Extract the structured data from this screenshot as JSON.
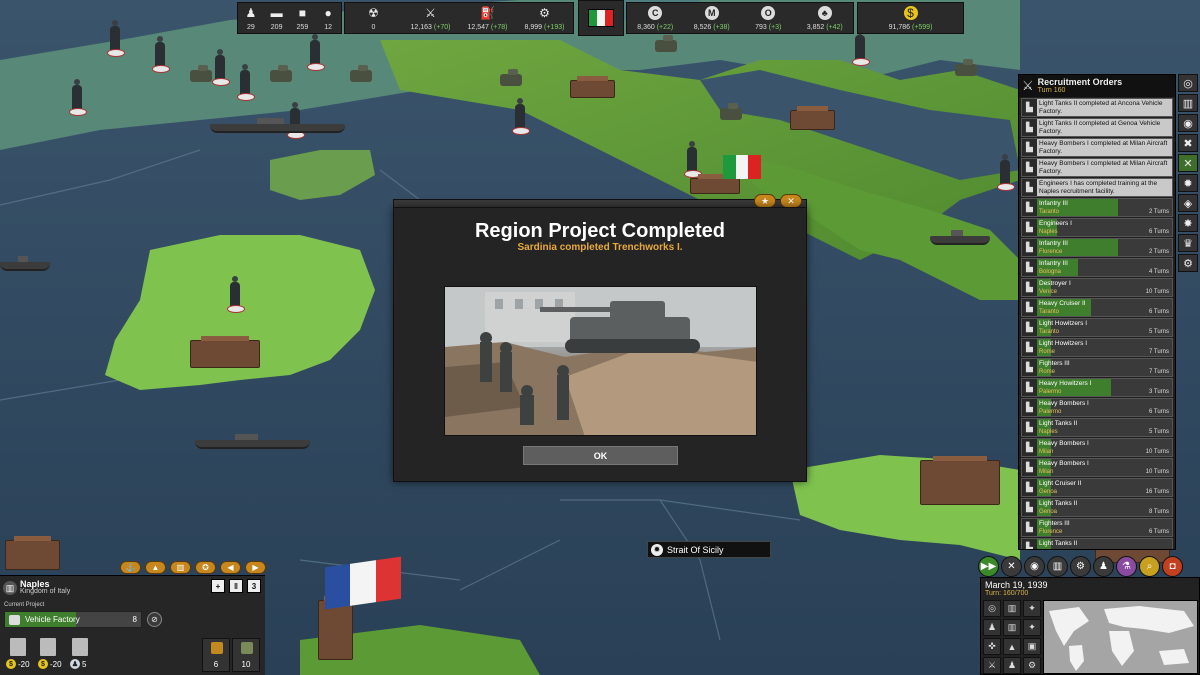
{
  "resources_left": [
    {
      "icon": "infantry-icon",
      "glyph": "♟",
      "value": "29"
    },
    {
      "icon": "truck-icon",
      "glyph": "▬",
      "value": "209"
    },
    {
      "icon": "tank-icon",
      "glyph": "■",
      "value": "259"
    },
    {
      "icon": "bomb-icon",
      "glyph": "●",
      "value": "12"
    }
  ],
  "resources_mid": [
    {
      "icon": "nuclear-icon",
      "glyph": "☢",
      "value": "0",
      "change": ""
    },
    {
      "icon": "manpower-icon",
      "glyph": "⚔",
      "value": "12,163",
      "change": "(+70)"
    },
    {
      "icon": "oil-icon",
      "glyph": "⛽",
      "value": "12,547",
      "change": "(+78)"
    },
    {
      "icon": "industry-icon",
      "glyph": "⚙",
      "value": "8,999",
      "change": "(+193)"
    }
  ],
  "resources_right": [
    {
      "icon": "coal-icon",
      "glyph": "C",
      "value": "8,360",
      "change": "(+22)"
    },
    {
      "icon": "metal-icon",
      "glyph": "M",
      "value": "8,526",
      "change": "(+38)"
    },
    {
      "icon": "oil-drop-icon",
      "glyph": "O",
      "value": "793",
      "change": "(+3)"
    },
    {
      "icon": "food-icon",
      "glyph": "♣",
      "value": "3,852",
      "change": "(+42)"
    }
  ],
  "money": {
    "icon": "money-icon",
    "glyph": "$",
    "value": "91,786",
    "change": "(+599)"
  },
  "recruitment": {
    "title": "Recruitment Orders",
    "turn": "Turn 160",
    "completed": [
      "Light Tanks II completed at Ancona Vehicle Factory.",
      "Light Tanks II completed at Genoa Vehicle Factory.",
      "Heavy Bombers I completed at Milan Aircraft Factory.",
      "Heavy Bombers I completed at Milan Aircraft Factory.",
      "Engineers I has completed training at the Naples recruitment facility."
    ],
    "orders": [
      {
        "unit": "Infantry III",
        "location": "Taranto",
        "turns": "2 Turns",
        "progress": 0.6
      },
      {
        "unit": "Engineers I",
        "location": "Naples",
        "turns": "6 Turns",
        "progress": 0.15
      },
      {
        "unit": "Infantry III",
        "location": "Florence",
        "turns": "2 Turns",
        "progress": 0.6
      },
      {
        "unit": "Infantry III",
        "location": "Bologna",
        "turns": "4 Turns",
        "progress": 0.3
      },
      {
        "unit": "Destroyer I",
        "location": "Venice",
        "turns": "10 Turns",
        "progress": 0.1
      },
      {
        "unit": "Heavy Cruiser II",
        "location": "Taranto",
        "turns": "6 Turns",
        "progress": 0.4
      },
      {
        "unit": "Light Howitzers I",
        "location": "Taranto",
        "turns": "5 Turns",
        "progress": 0.1
      },
      {
        "unit": "Light Howitzers I",
        "location": "Rome",
        "turns": "7 Turns",
        "progress": 0.1
      },
      {
        "unit": "Fighters III",
        "location": "Rome",
        "turns": "7 Turns",
        "progress": 0.1
      },
      {
        "unit": "Heavy Howitzers I",
        "location": "Palermo",
        "turns": "3 Turns",
        "progress": 0.55
      },
      {
        "unit": "Heavy Bombers I",
        "location": "Palermo",
        "turns": "6 Turns",
        "progress": 0.1
      },
      {
        "unit": "Light Tanks II",
        "location": "Naples",
        "turns": "5 Turns",
        "progress": 0.1
      },
      {
        "unit": "Heavy Bombers I",
        "location": "Milan",
        "turns": "10 Turns",
        "progress": 0.1
      },
      {
        "unit": "Heavy Bombers I",
        "location": "Milan",
        "turns": "10 Turns",
        "progress": 0.1
      },
      {
        "unit": "Light Cruiser II",
        "location": "Genoa",
        "turns": "16 Turns",
        "progress": 0.1
      },
      {
        "unit": "Light Tanks II",
        "location": "Genoa",
        "turns": "8 Turns",
        "progress": 0.1
      },
      {
        "unit": "Fighters III",
        "location": "Florence",
        "turns": "6 Turns",
        "progress": 0.1
      },
      {
        "unit": "Light Tanks II",
        "location": "",
        "turns": "",
        "progress": 0.1
      }
    ]
  },
  "side_menu": [
    {
      "icon": "globe-icon",
      "glyph": "◎"
    },
    {
      "icon": "government-icon",
      "glyph": "▥"
    },
    {
      "icon": "diplomacy-icon",
      "glyph": "◉"
    },
    {
      "icon": "tools-icon",
      "glyph": "✖"
    },
    {
      "icon": "military-icon",
      "glyph": "✕"
    },
    {
      "icon": "fire-icon",
      "glyph": "✹"
    },
    {
      "icon": "shield-icon",
      "glyph": "◈"
    },
    {
      "icon": "burst-icon",
      "glyph": "✸"
    },
    {
      "icon": "research-icon",
      "glyph": "♛"
    },
    {
      "icon": "settings-icon",
      "glyph": "⚙"
    }
  ],
  "modal": {
    "title": "Region Project Completed",
    "subtitle": "Sardinia completed Trenchworks I.",
    "ok_label": "OK",
    "tab_star": "★",
    "tab_close": "✕"
  },
  "strait_label": "Strait Of Sicily",
  "region": {
    "name": "Naples",
    "kingdom": "Kingdom of Italy",
    "current_project_label": "Current Project",
    "project_name": "Vehicle Factory",
    "project_count": "8",
    "project_progress": 0.52,
    "cancel_glyph": "⊘",
    "money_1": "-20",
    "money_2": "-20",
    "pop": "5",
    "side_val_1": "6",
    "side_val_2": "10",
    "top_badge_1": "+",
    "top_badge_2": "‖",
    "top_badge_3": "3"
  },
  "bottom_actions": [
    "⚓",
    "▲",
    "▥",
    "✪",
    "◀",
    "▶"
  ],
  "date_panel": {
    "date": "March 19, 1939",
    "turn": "Turn: 160/700"
  },
  "end_turn_buttons": [
    {
      "icon": "end-turn-icon",
      "glyph": "▶▶"
    },
    {
      "icon": "battle-icon",
      "glyph": "✕"
    },
    {
      "icon": "world-icon",
      "glyph": "◉"
    },
    {
      "icon": "building-icon",
      "glyph": "▥"
    },
    {
      "icon": "gear-icon",
      "glyph": "⚙"
    },
    {
      "icon": "population-icon",
      "glyph": "♟"
    },
    {
      "icon": "flask-icon",
      "glyph": "⚗"
    },
    {
      "icon": "search-icon",
      "glyph": "⌕"
    },
    {
      "icon": "camera-icon",
      "glyph": "◘"
    }
  ],
  "map_grid": [
    "◎",
    "▥",
    "✦",
    "♟",
    "▥",
    "✦",
    "✜",
    "▲",
    "▣",
    "⚔",
    "♟",
    "⚙"
  ]
}
